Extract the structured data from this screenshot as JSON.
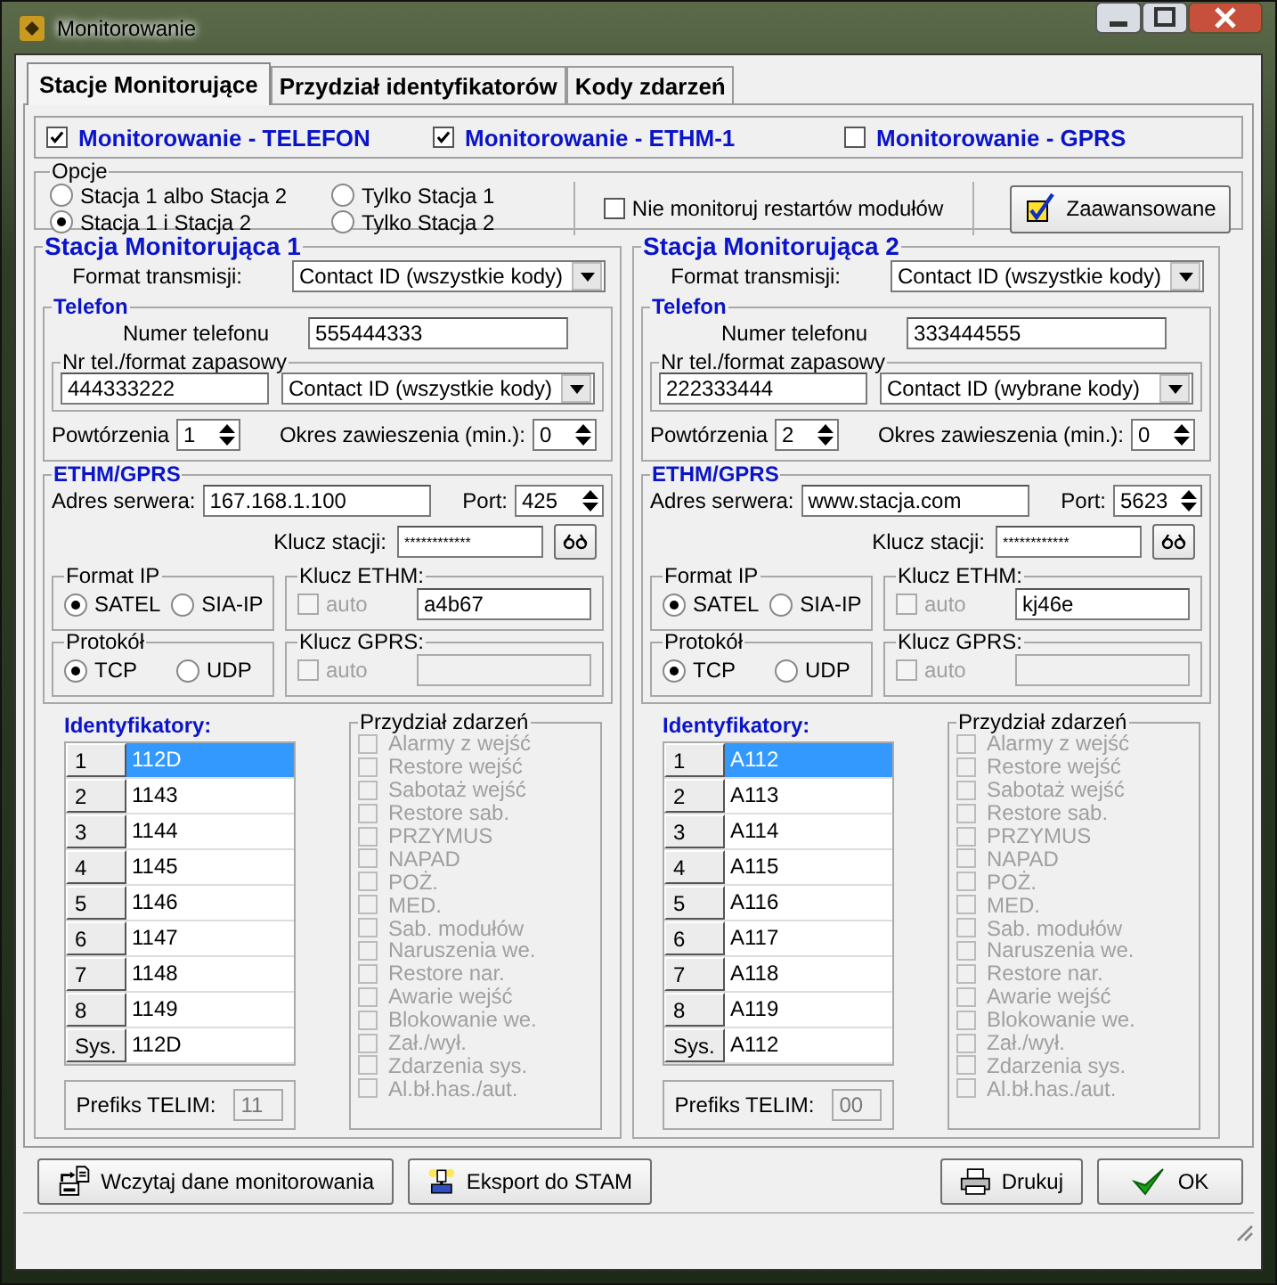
{
  "window": {
    "title": "Monitorowanie"
  },
  "tabs": [
    {
      "label": "Stacje Monitorujące",
      "selected": true
    },
    {
      "label": "Przydział identyfikatorów",
      "selected": false
    },
    {
      "label": "Kody zdarzeń",
      "selected": false
    }
  ],
  "channels": [
    {
      "label": "Monitorowanie - TELEFON",
      "checked": true
    },
    {
      "label": "Monitorowanie - ETHM-1",
      "checked": true
    },
    {
      "label": "Monitorowanie - GPRS",
      "checked": false
    }
  ],
  "options": {
    "title": "Opcje",
    "radios": [
      {
        "label": "Stacja 1 albo Stacja 2",
        "selected": false
      },
      {
        "label": "Stacja 1 i Stacja 2",
        "selected": true
      },
      {
        "label": "Tylko Stacja 1",
        "selected": false
      },
      {
        "label": "Tylko Stacja 2",
        "selected": false
      }
    ],
    "restart_checkbox": {
      "label": "Nie monitoruj restartów modułów",
      "checked": false
    },
    "advanced_button": "Zaawansowane"
  },
  "stations": [
    {
      "title": "Stacja Monitorująca 1",
      "format_label": "Format transmisji:",
      "format_value": "Contact ID (wszystkie kody)",
      "phone": {
        "title": "Telefon",
        "number_label": "Numer telefonu",
        "number_value": "555444333",
        "backup_title": "Nr tel./format zapasowy",
        "backup_number": "444333222",
        "backup_format": "Contact ID (wszystkie kody)",
        "repeats_label": "Powtórzenia",
        "repeats_value": "1",
        "suspend_label": "Okres zawieszenia (min.):",
        "suspend_value": "0"
      },
      "ethm": {
        "title": "ETHM/GPRS",
        "server_label": "Adres serwera:",
        "server_value": "167.168.1.100",
        "port_label": "Port:",
        "port_value": "425",
        "key_label": "Klucz stacji:",
        "key_value": "************",
        "format_ip": {
          "title": "Format IP",
          "options": [
            {
              "label": "SATEL",
              "selected": true
            },
            {
              "label": "SIA-IP",
              "selected": false
            }
          ]
        },
        "ethm_key": {
          "title": "Klucz ETHM:",
          "auto_label": "auto",
          "auto_checked": false,
          "value": "a4b67"
        },
        "protocol": {
          "title": "Protokół",
          "options": [
            {
              "label": "TCP",
              "selected": true
            },
            {
              "label": "UDP",
              "selected": false
            }
          ]
        },
        "gprs_key": {
          "title": "Klucz GPRS:",
          "auto_label": "auto",
          "auto_checked": false
        }
      },
      "identifiers": {
        "title": "Identyfikatory:",
        "rows": [
          {
            "key": "1",
            "value": "112D",
            "selected": true
          },
          {
            "key": "2",
            "value": "1143",
            "selected": false
          },
          {
            "key": "3",
            "value": "1144",
            "selected": false
          },
          {
            "key": "4",
            "value": "1145",
            "selected": false
          },
          {
            "key": "5",
            "value": "1146",
            "selected": false
          },
          {
            "key": "6",
            "value": "1147",
            "selected": false
          },
          {
            "key": "7",
            "value": "1148",
            "selected": false
          },
          {
            "key": "8",
            "value": "1149",
            "selected": false
          },
          {
            "key": "Sys.",
            "value": "112D",
            "selected": false
          }
        ],
        "prefix_label": "Prefiks TELIM:",
        "prefix_value": "11"
      },
      "events": {
        "title": "Przydział zdarzeń",
        "disabled": true,
        "items": [
          {
            "label": "Alarmy z wejść",
            "checked": false
          },
          {
            "label": "Restore wejść",
            "checked": false
          },
          {
            "label": "Sabotaż wejść",
            "checked": false
          },
          {
            "label": "Restore sab.",
            "checked": false
          },
          {
            "label": "PRZYMUS",
            "checked": false
          },
          {
            "label": "NAPAD",
            "checked": false
          },
          {
            "label": "POŻ.",
            "checked": false
          },
          {
            "label": "MED.",
            "checked": false
          },
          {
            "label": "Sab. modułów",
            "checked": false
          },
          {
            "label": "Naruszenia we.",
            "checked": false
          },
          {
            "label": "Restore nar.",
            "checked": false
          },
          {
            "label": "Awarie wejść",
            "checked": false
          },
          {
            "label": "Blokowanie we.",
            "checked": false
          },
          {
            "label": "Zał./wył.",
            "checked": false
          },
          {
            "label": "Zdarzenia sys.",
            "checked": false
          },
          {
            "label": "Al.bł.has./aut.",
            "checked": false
          }
        ]
      }
    },
    {
      "title": "Stacja Monitorująca 2",
      "format_label": "Format transmisji:",
      "format_value": "Contact ID (wszystkie kody)",
      "phone": {
        "title": "Telefon",
        "number_label": "Numer telefonu",
        "number_value": "333444555",
        "backup_title": "Nr tel./format zapasowy",
        "backup_number": "222333444",
        "backup_format": "Contact ID (wybrane kody)",
        "repeats_label": "Powtórzenia",
        "repeats_value": "2",
        "suspend_label": "Okres zawieszenia (min.):",
        "suspend_value": "0"
      },
      "ethm": {
        "title": "ETHM/GPRS",
        "server_label": "Adres serwera:",
        "server_value": "www.stacja.com",
        "port_label": "Port:",
        "port_value": "5623",
        "key_label": "Klucz stacji:",
        "key_value": "************",
        "format_ip": {
          "title": "Format IP",
          "options": [
            {
              "label": "SATEL",
              "selected": true
            },
            {
              "label": "SIA-IP",
              "selected": false
            }
          ]
        },
        "ethm_key": {
          "title": "Klucz ETHM:",
          "auto_label": "auto",
          "auto_checked": false,
          "value": "kj46e"
        },
        "protocol": {
          "title": "Protokół",
          "options": [
            {
              "label": "TCP",
              "selected": true
            },
            {
              "label": "UDP",
              "selected": false
            }
          ]
        },
        "gprs_key": {
          "title": "Klucz GPRS:",
          "auto_label": "auto",
          "auto_checked": false
        }
      },
      "identifiers": {
        "title": "Identyfikatory:",
        "rows": [
          {
            "key": "1",
            "value": "A112",
            "selected": true
          },
          {
            "key": "2",
            "value": "A113",
            "selected": false
          },
          {
            "key": "3",
            "value": "A114",
            "selected": false
          },
          {
            "key": "4",
            "value": "A115",
            "selected": false
          },
          {
            "key": "5",
            "value": "A116",
            "selected": false
          },
          {
            "key": "6",
            "value": "A117",
            "selected": false
          },
          {
            "key": "7",
            "value": "A118",
            "selected": false
          },
          {
            "key": "8",
            "value": "A119",
            "selected": false
          },
          {
            "key": "Sys.",
            "value": "A112",
            "selected": false
          }
        ],
        "prefix_label": "Prefiks TELIM:",
        "prefix_value": "00"
      },
      "events": {
        "title": "Przydział zdarzeń",
        "disabled": true,
        "items": [
          {
            "label": "Alarmy z wejść",
            "checked": false
          },
          {
            "label": "Restore wejść",
            "checked": false
          },
          {
            "label": "Sabotaż wejść",
            "checked": false
          },
          {
            "label": "Restore sab.",
            "checked": false
          },
          {
            "label": "PRZYMUS",
            "checked": false
          },
          {
            "label": "NAPAD",
            "checked": false
          },
          {
            "label": "POŻ.",
            "checked": false
          },
          {
            "label": "MED.",
            "checked": false
          },
          {
            "label": "Sab. modułów",
            "checked": false
          },
          {
            "label": "Naruszenia we.",
            "checked": false
          },
          {
            "label": "Restore nar.",
            "checked": false
          },
          {
            "label": "Awarie wejść",
            "checked": false
          },
          {
            "label": "Blokowanie we.",
            "checked": false
          },
          {
            "label": "Zał./wył.",
            "checked": false
          },
          {
            "label": "Zdarzenia sys.",
            "checked": false
          },
          {
            "label": "Al.bł.has./aut.",
            "checked": false
          }
        ]
      }
    }
  ],
  "footer_buttons": [
    {
      "label": "Wczytaj dane monitorowania",
      "kind": "load"
    },
    {
      "label": "Eksport do STAM",
      "kind": "export"
    },
    {
      "label": "Drukuj",
      "kind": "print"
    },
    {
      "label": "OK",
      "kind": "ok"
    }
  ]
}
